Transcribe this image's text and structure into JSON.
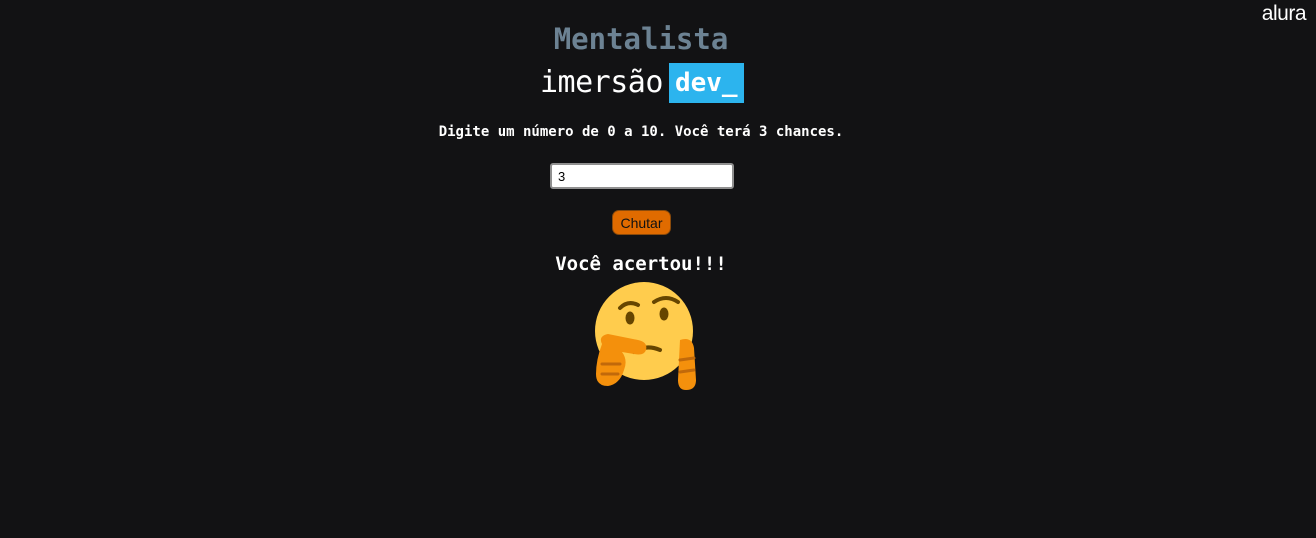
{
  "header": {
    "logo": "alura"
  },
  "page": {
    "title": "Mentalista",
    "brand_word": "imersão",
    "brand_tag": "dev_"
  },
  "game": {
    "instructions": "Digite um número de 0 a 10. Você terá 3 chances.",
    "input_value": "3",
    "button_label": "Chutar",
    "result_message": "Você acertou!!!",
    "result_image": "thinking-face-emoji"
  },
  "colors": {
    "background": "#121214",
    "title": "#6c8293",
    "brand_highlight": "#2cb4ee",
    "button": "#e06b00"
  }
}
